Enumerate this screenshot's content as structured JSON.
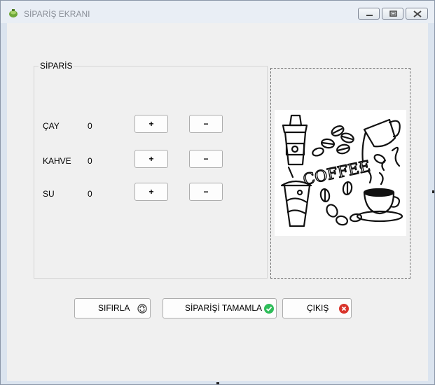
{
  "window": {
    "title": "SİPARİŞ EKRANI"
  },
  "order_group": {
    "title": "SİPARİS",
    "items": [
      {
        "name": "ÇAY",
        "quantity": "0",
        "plus_label": "+",
        "minus_label": "−"
      },
      {
        "name": "KAHVE",
        "quantity": "0",
        "plus_label": "+",
        "minus_label": "−"
      },
      {
        "name": "SU",
        "quantity": "0",
        "plus_label": "+",
        "minus_label": "−"
      }
    ]
  },
  "picture": {
    "icon": "coffee-illustration",
    "word": "COFFEE"
  },
  "actions": {
    "reset_label": "SIFIRLA",
    "complete_label": "SİPARİŞİ TAMAMLA",
    "exit_label": "ÇIKIŞ"
  },
  "colors": {
    "complete_icon": "#2ebd59",
    "exit_icon": "#d9342b",
    "title_text": "#8a8f98"
  }
}
